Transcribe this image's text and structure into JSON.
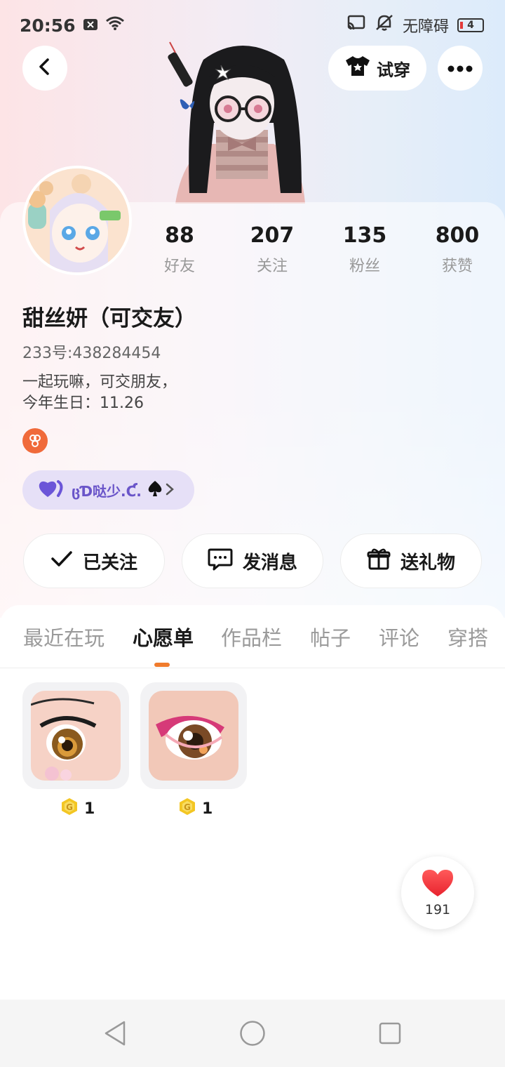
{
  "status_bar": {
    "time": "20:56",
    "accessibility_label": "无障碍",
    "battery_level": "4"
  },
  "header": {
    "try_on_label": "试穿"
  },
  "profile": {
    "stats": [
      {
        "value": "88",
        "label": "好友"
      },
      {
        "value": "207",
        "label": "关注"
      },
      {
        "value": "135",
        "label": "粉丝"
      },
      {
        "value": "800",
        "label": "获赞"
      }
    ],
    "nickname": "甜丝妍（可交友）",
    "uid": "233号:438284454",
    "bio_lines": [
      "一起玩嘛，可交朋友，",
      "今年生日：11.26"
    ],
    "couple_tag": "ცƊ哒少.Ƈ."
  },
  "actions": {
    "follow_label": "已关注",
    "message_label": "发消息",
    "gift_label": "送礼物"
  },
  "tabs": [
    {
      "label": "最近在玩",
      "active": false
    },
    {
      "label": "心愿单",
      "active": true
    },
    {
      "label": "作品栏",
      "active": false
    },
    {
      "label": "帖子",
      "active": false
    },
    {
      "label": "评论",
      "active": false
    },
    {
      "label": "穿搭",
      "active": false
    }
  ],
  "wishlist": [
    {
      "price": "1"
    },
    {
      "price": "1"
    }
  ],
  "like": {
    "count": "191"
  },
  "colors": {
    "accent": "#f07b2c",
    "couple_tag_bg": "#e6e0f7",
    "couple_tag_text": "#6a55c9",
    "coin": "#f3c623"
  }
}
